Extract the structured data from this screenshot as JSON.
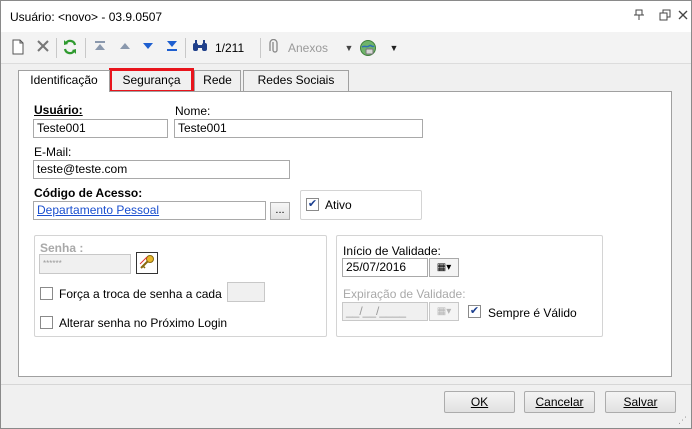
{
  "window": {
    "title": "Usuário: <novo> - 03.9.0507",
    "icons": [
      "pin-icon",
      "restore-icon",
      "close-icon"
    ]
  },
  "toolbar": {
    "record_counter": "1/211",
    "attachments_label": "Anexos",
    "icons": [
      "new-doc-icon",
      "delete-icon",
      "refresh-icon",
      "first-icon",
      "prev-icon",
      "next-icon",
      "last-icon",
      "binoculars-icon",
      "attach-icon",
      "globe-icon"
    ]
  },
  "tabs": [
    {
      "label": "Identificação"
    },
    {
      "label": "Segurança"
    },
    {
      "label": "Rede"
    },
    {
      "label": "Redes Sociais"
    }
  ],
  "form": {
    "usuario_label": "Usuário:",
    "usuario_value": "Teste001",
    "nome_label": "Nome:",
    "nome_value": "Teste001",
    "email_label": "E-Mail:",
    "email_value": "teste@teste.com",
    "codigo_label": "Código de Acesso:",
    "codigo_value": "Departamento Pessoal",
    "browse_label": "...",
    "ativo_label": "Ativo",
    "ativo_checked": true,
    "senha_label": "Senha :",
    "senha_value": "******",
    "forca_troca_label": "Força a troca de senha a cada",
    "forca_troca_checked": false,
    "alterar_senha_label": "Alterar senha no Próximo Login",
    "alterar_senha_checked": false,
    "inicio_validade_label": "Início de Validade:",
    "inicio_validade_value": "25/07/2016",
    "expiracao_label": "Expiração de Validade:",
    "expiracao_value": "__/__/____",
    "sempre_valido_label": "Sempre é Válido",
    "sempre_valido_checked": true
  },
  "buttons": {
    "ok": "OK",
    "cancelar": "Cancelar",
    "salvar": "Salvar"
  },
  "colors": {
    "highlight": "#e8141c",
    "link": "#1a4fcf"
  }
}
